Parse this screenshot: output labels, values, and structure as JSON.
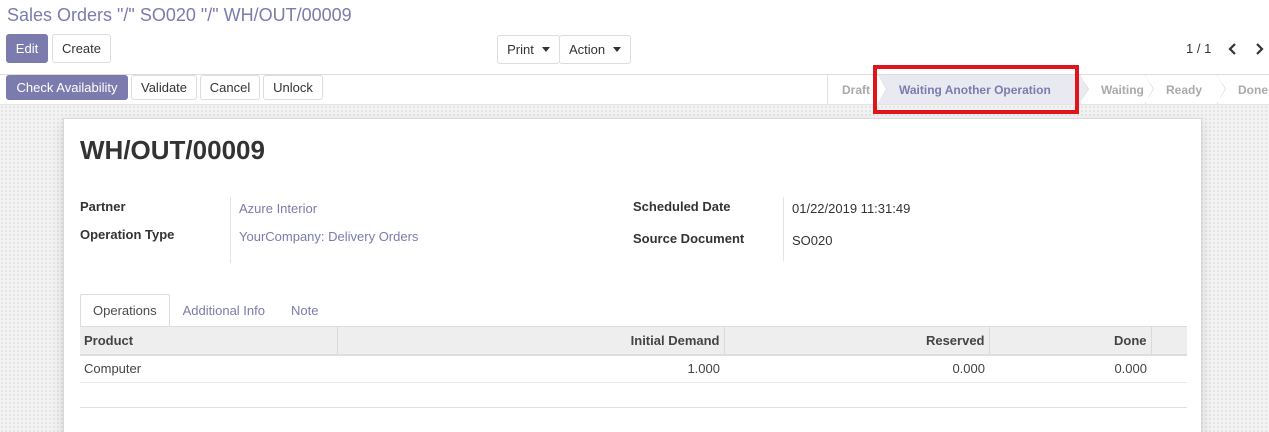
{
  "breadcrumb": "Sales Orders \"/\" SO020 \"/\" WH/OUT/00009",
  "control_panel": {
    "edit_label": "Edit",
    "create_label": "Create",
    "print_label": "Print",
    "action_label": "Action",
    "pager": "1 / 1"
  },
  "header_buttons": {
    "check_availability": "Check Availability",
    "validate": "Validate",
    "cancel": "Cancel",
    "unlock": "Unlock"
  },
  "statusbar": {
    "stages": [
      "Draft",
      "Waiting Another Operation",
      "Waiting",
      "Ready",
      "Done"
    ],
    "active": "Waiting Another Operation",
    "highlight_color": "#e0141c"
  },
  "record": {
    "title": "WH/OUT/00009",
    "partner_label": "Partner",
    "partner_value": "Azure Interior",
    "operation_type_label": "Operation Type",
    "operation_type_value": "YourCompany: Delivery Orders",
    "scheduled_date_label": "Scheduled Date",
    "scheduled_date_value": "01/22/2019 11:31:49",
    "source_document_label": "Source Document",
    "source_document_value": "SO020"
  },
  "tabs": [
    "Operations",
    "Additional Info",
    "Note"
  ],
  "operations": {
    "columns": [
      "Product",
      "Initial Demand",
      "Reserved",
      "Done"
    ],
    "rows": [
      {
        "product": "Computer",
        "initial_demand": "1.000",
        "reserved": "0.000",
        "done": "0.000"
      }
    ]
  },
  "colors": {
    "brand": "#7c7bad",
    "active_stage_bg": "#e9e9f1"
  }
}
